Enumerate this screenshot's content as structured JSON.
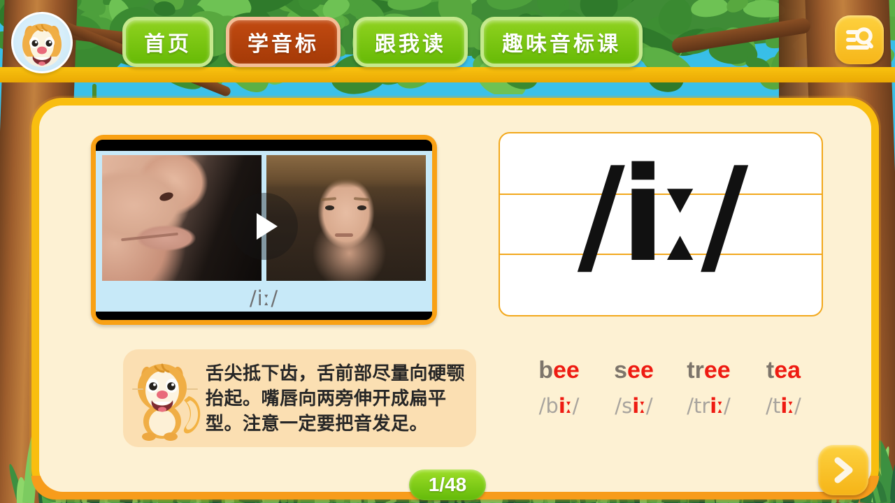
{
  "header": {
    "avatar_alt": "chipmunk-mascot",
    "nav": [
      {
        "label": "首页",
        "active": false
      },
      {
        "label": "学音标",
        "active": true
      },
      {
        "label": "跟我读",
        "active": false
      },
      {
        "label": "趣味音标课",
        "active": false
      }
    ],
    "search_icon": "list-search-icon"
  },
  "video": {
    "caption": "/iː/",
    "play_icon": "play-icon",
    "left_panel_alt": "mouth-side-view",
    "right_panel_alt": "face-front-view"
  },
  "copybook": {
    "symbol": "/iː/"
  },
  "tip": {
    "mascot_alt": "chipmunk-teacher",
    "text": "舌尖抵下齿，舌前部尽量向硬颚抬起。嘴唇向两旁伸开成扁平型。注意一定要把音发足。"
  },
  "words": [
    {
      "prefix": "b",
      "highlight": "ee",
      "ipa_prefix": "/b",
      "ipa_highlight": "iː",
      "ipa_suffix": "/"
    },
    {
      "prefix": "s",
      "highlight": "ee",
      "ipa_prefix": "/s",
      "ipa_highlight": "iː",
      "ipa_suffix": "/"
    },
    {
      "prefix": "tr",
      "highlight": "ee",
      "ipa_prefix": "/tr",
      "ipa_highlight": "iː",
      "ipa_suffix": "/"
    },
    {
      "prefix": "t",
      "highlight": "ea",
      "ipa_prefix": "/t",
      "ipa_highlight": "iː",
      "ipa_suffix": "/"
    }
  ],
  "footer": {
    "pager": "1/48",
    "next_icon": "chevron-right-icon"
  },
  "colors": {
    "sky": "#35bde8",
    "panel_border": "#f9be0f",
    "panel_bg": "#fdf1d3",
    "nav_green": "#7ac50e",
    "nav_active": "#b24410",
    "accent_red": "#ee1b12",
    "tip_bg": "#fbdfb2",
    "pager_green": "#7ecc16"
  }
}
